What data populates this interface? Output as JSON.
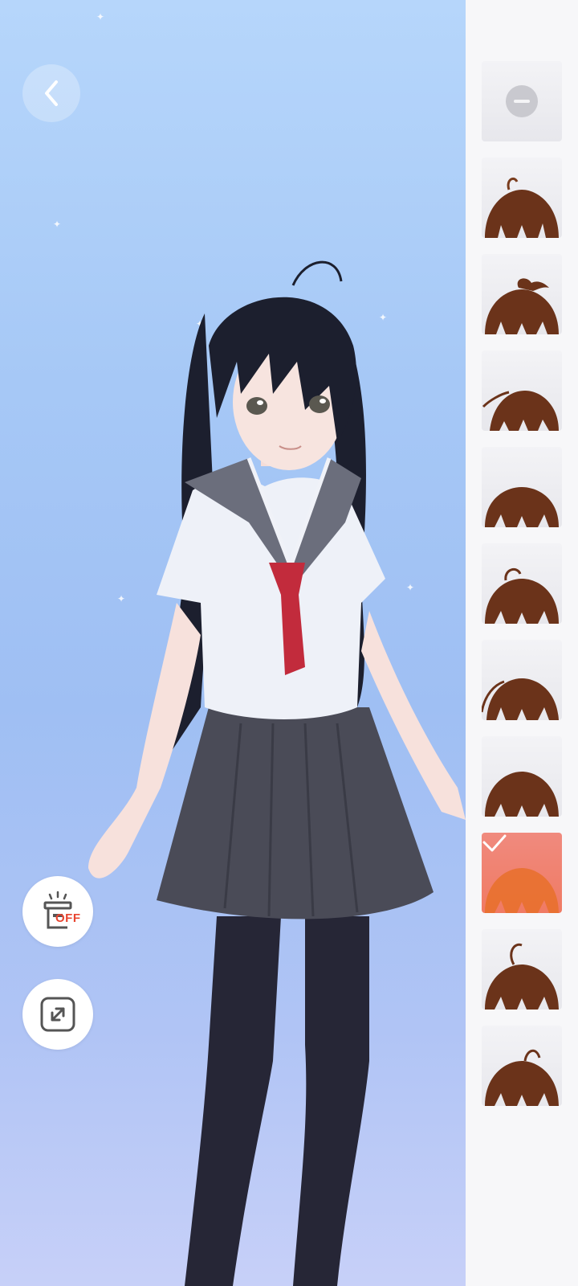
{
  "screen": {
    "background_top": "#b6d6fb",
    "background_bottom": "#c7d0f8"
  },
  "toolbar": {
    "back_icon": "chevron-left-icon",
    "toggle_off_label": "OFF",
    "toggle_icon": "lamp-icon",
    "fullscreen_icon": "expand-icon"
  },
  "hair_panel": {
    "selected_index": 8,
    "accent": "#f07a63",
    "items": [
      {
        "kind": "none",
        "icon": "none-icon"
      },
      {
        "kind": "hair",
        "icon": "hairstyle-icon"
      },
      {
        "kind": "hair",
        "icon": "hairstyle-icon"
      },
      {
        "kind": "hair",
        "icon": "hairstyle-icon"
      },
      {
        "kind": "hair",
        "icon": "hairstyle-icon"
      },
      {
        "kind": "hair",
        "icon": "hairstyle-icon"
      },
      {
        "kind": "hair",
        "icon": "hairstyle-icon"
      },
      {
        "kind": "hair",
        "icon": "hairstyle-icon"
      },
      {
        "kind": "hair",
        "icon": "hairstyle-icon",
        "selected": true
      },
      {
        "kind": "hair",
        "icon": "hairstyle-icon"
      },
      {
        "kind": "hair",
        "icon": "hairstyle-icon"
      }
    ]
  }
}
